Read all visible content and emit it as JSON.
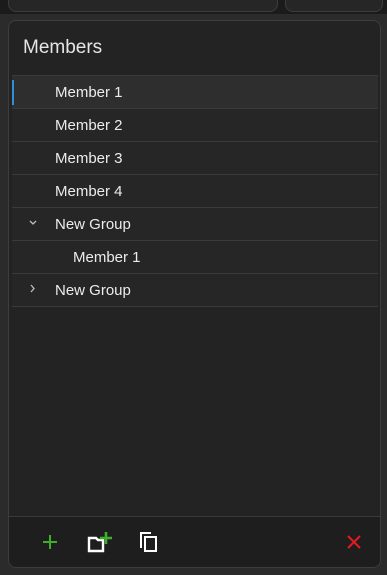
{
  "panel": {
    "title": "Members"
  },
  "list": [
    {
      "label": "Member 1",
      "type": "member",
      "level": 0,
      "selected": true
    },
    {
      "label": "Member 2",
      "type": "member",
      "level": 0,
      "selected": false
    },
    {
      "label": "Member 3",
      "type": "member",
      "level": 0,
      "selected": false
    },
    {
      "label": "Member 4",
      "type": "member",
      "level": 0,
      "selected": false
    },
    {
      "label": "New Group",
      "type": "group",
      "expanded": true,
      "level": 0,
      "selected": false
    },
    {
      "label": "Member 1",
      "type": "member",
      "level": 1,
      "selected": false
    },
    {
      "label": "New Group",
      "type": "group",
      "expanded": false,
      "level": 0,
      "selected": false
    }
  ],
  "toolbar": {
    "add_icon": "plus-icon",
    "add_group_icon": "folder-add-icon",
    "duplicate_icon": "copy-icon",
    "delete_icon": "close-icon"
  },
  "colors": {
    "add": "#3fae2a",
    "delete": "#e21b1b",
    "accent": "#2f8fdb"
  }
}
